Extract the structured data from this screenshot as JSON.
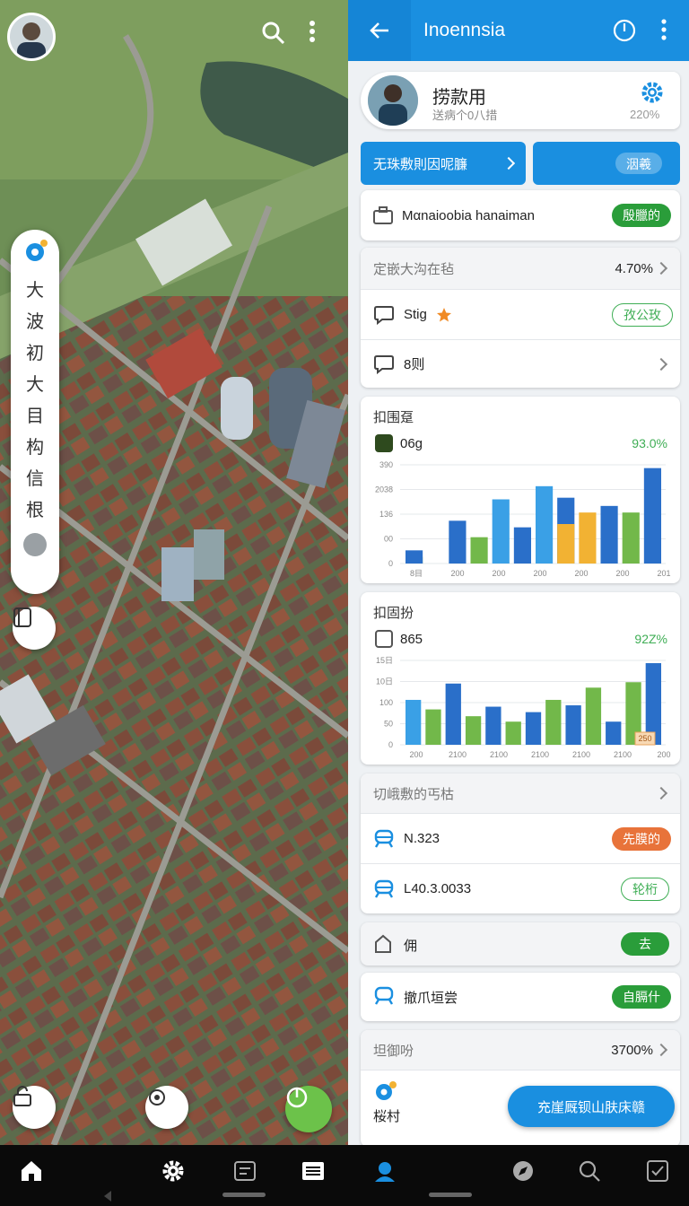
{
  "map": {
    "sidebar_chars": [
      "大",
      "波",
      "初",
      "大",
      "目",
      "构",
      "信",
      "根"
    ]
  },
  "panel": {
    "title": "Inoennsia",
    "profile": {
      "name": "捞款用",
      "subtitle": "送病个0八措",
      "percent": "220%"
    },
    "primary_button": "无珠敷則因呢臁",
    "secondary_button": "洇羲",
    "info_row": {
      "text": "Mαnaioobia hanaiman",
      "badge": "殷臘的"
    },
    "list1": {
      "header": "定嵌大沟在毡",
      "header_value": "4.70%",
      "items": [
        {
          "label": "Stig",
          "badge": "孜公玫",
          "starred": true
        },
        {
          "label": "8则"
        }
      ]
    },
    "chart1": {
      "title": "扣围趸",
      "subtitle": "06g",
      "percent": "93.0%",
      "y_ticks": [
        "390",
        "2038",
        "136",
        "00",
        "0"
      ],
      "x_ticks": [
        "8目",
        "200",
        "200",
        "200",
        "200",
        "200",
        "201"
      ]
    },
    "chart2": {
      "title": "扣固扮",
      "subtitle": "865",
      "percent": "92Z%",
      "y_ticks": [
        "15日",
        "10日",
        "100",
        "50",
        "0"
      ],
      "x_ticks": [
        "200",
        "2100",
        "2100",
        "2100",
        "2100",
        "2100",
        "200"
      ],
      "tag": "250"
    },
    "list2": {
      "header": "切峨敷的丐枯",
      "items": [
        {
          "label": "N.323",
          "badge": "先膜的",
          "badge_style": "orange"
        },
        {
          "label": "L40.3.0033",
          "badge": "轮桁",
          "badge_style": "outline"
        }
      ]
    },
    "row_single1": {
      "label": "佣",
      "badge": "去"
    },
    "row_single2": {
      "label": "撤爪垣尝",
      "badge": "自膈什"
    },
    "list3": {
      "header": "坦御吩",
      "header_value": "3700%",
      "item": "桜村"
    },
    "fab_label": "充崖厩钡山肤床赣"
  },
  "colors": {
    "accent": "#1a8fe0",
    "green": "#2a9d3a",
    "orange": "#e8733a"
  },
  "chart_data": [
    {
      "type": "bar",
      "title": "扣围趸",
      "series": [
        {
          "color": "#72b84a",
          "values": [
            8,
            0,
            0,
            32,
            0,
            0,
            0,
            0,
            0,
            0,
            62,
            0
          ]
        },
        {
          "color": "#2a6fc9",
          "values": [
            16,
            0,
            52,
            0,
            0,
            44,
            0,
            80,
            0,
            70,
            0,
            116
          ]
        },
        {
          "color": "#3aa0e6",
          "values": [
            0,
            0,
            0,
            0,
            78,
            0,
            94,
            0,
            0,
            0,
            0,
            0
          ]
        },
        {
          "color": "#f2b233",
          "values": [
            0,
            0,
            0,
            0,
            0,
            0,
            0,
            48,
            62,
            0,
            0,
            0
          ]
        }
      ]
    },
    {
      "type": "bar",
      "title": "扣固扮",
      "series": [
        {
          "color": "#3aa0e6",
          "values": [
            66,
            0,
            0,
            0,
            0,
            0,
            0,
            0,
            0,
            0,
            0,
            0
          ]
        },
        {
          "color": "#72b84a",
          "values": [
            0,
            52,
            0,
            42,
            0,
            34,
            0,
            66,
            0,
            84,
            0,
            92
          ]
        },
        {
          "color": "#2a6fc9",
          "values": [
            0,
            0,
            90,
            0,
            56,
            0,
            48,
            0,
            58,
            0,
            34,
            0,
            120
          ]
        }
      ]
    }
  ]
}
